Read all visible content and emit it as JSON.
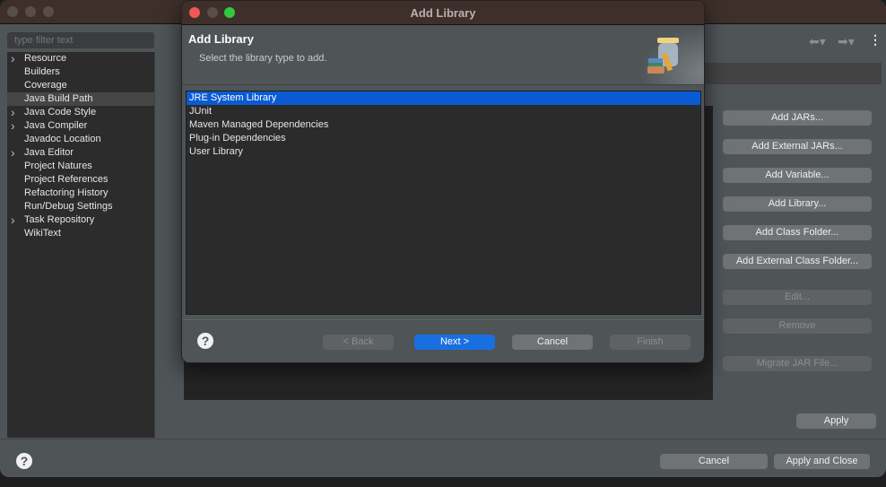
{
  "main_window": {
    "filter_placeholder": "type filter text",
    "tree": [
      {
        "label": "Resource",
        "expandable": true
      },
      {
        "label": "Builders",
        "expandable": false
      },
      {
        "label": "Coverage",
        "expandable": false
      },
      {
        "label": "Java Build Path",
        "expandable": false,
        "selected": true
      },
      {
        "label": "Java Code Style",
        "expandable": true
      },
      {
        "label": "Java Compiler",
        "expandable": true
      },
      {
        "label": "Javadoc Location",
        "expandable": false
      },
      {
        "label": "Java Editor",
        "expandable": true
      },
      {
        "label": "Project Natures",
        "expandable": false
      },
      {
        "label": "Project References",
        "expandable": false
      },
      {
        "label": "Refactoring History",
        "expandable": false
      },
      {
        "label": "Run/Debug Settings",
        "expandable": false
      },
      {
        "label": "Task Repository",
        "expandable": true
      },
      {
        "label": "WikiText",
        "expandable": false
      }
    ],
    "side_buttons": {
      "add_jars": "Add JARs...",
      "add_external_jars": "Add External JARs...",
      "add_variable": "Add Variable...",
      "add_library": "Add Library...",
      "add_class_folder": "Add Class Folder...",
      "add_external_class_folder": "Add External Class Folder...",
      "edit": "Edit...",
      "remove": "Remove",
      "migrate": "Migrate JAR File..."
    },
    "apply": "Apply",
    "cancel": "Cancel",
    "apply_and_close": "Apply and Close",
    "help_icon": "?"
  },
  "dialog": {
    "window_title": "Add Library",
    "header_title": "Add Library",
    "header_desc": "Select the library type to add.",
    "items": [
      "JRE System Library",
      "JUnit",
      "Maven Managed Dependencies",
      "Plug-in Dependencies",
      "User Library"
    ],
    "selected_index": 0,
    "back": "< Back",
    "next": "Next >",
    "cancel": "Cancel",
    "finish": "Finish",
    "help_icon": "?",
    "accent": "#0a5bd3"
  }
}
